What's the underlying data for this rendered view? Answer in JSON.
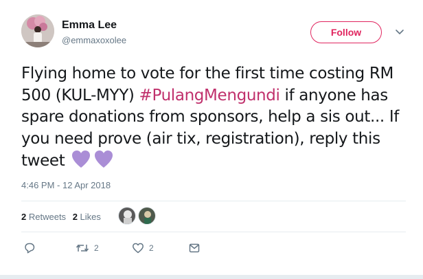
{
  "author": {
    "name": "Emma Lee",
    "handle": "@emmaxoxolee",
    "follow_label": "Follow"
  },
  "tweet": {
    "text_part1": "Flying home to vote for the first time costing RM 500 (KUL-MYY) ",
    "hashtag": "#PulangMengundi",
    "text_part2": " if anyone has spare donations from sponsors, help a sis out... If you need prove (air tix, registration), reply this tweet",
    "emoji": "purple-heart x2"
  },
  "timestamp": "4:46 PM - 12 Apr 2018",
  "stats": {
    "retweets_count": "2",
    "retweets_label": "Retweets",
    "likes_count": "2",
    "likes_label": "Likes"
  },
  "actions": {
    "reply_icon": "reply-icon",
    "retweet_icon": "retweet-icon",
    "retweet_count": "2",
    "like_icon": "heart-icon",
    "like_count": "2",
    "dm_icon": "envelope-icon"
  },
  "colors": {
    "follow_accent": "#e0245e",
    "hashtag": "#c0306c",
    "muted": "#657786",
    "heart_emoji": "#aa8ed6"
  }
}
